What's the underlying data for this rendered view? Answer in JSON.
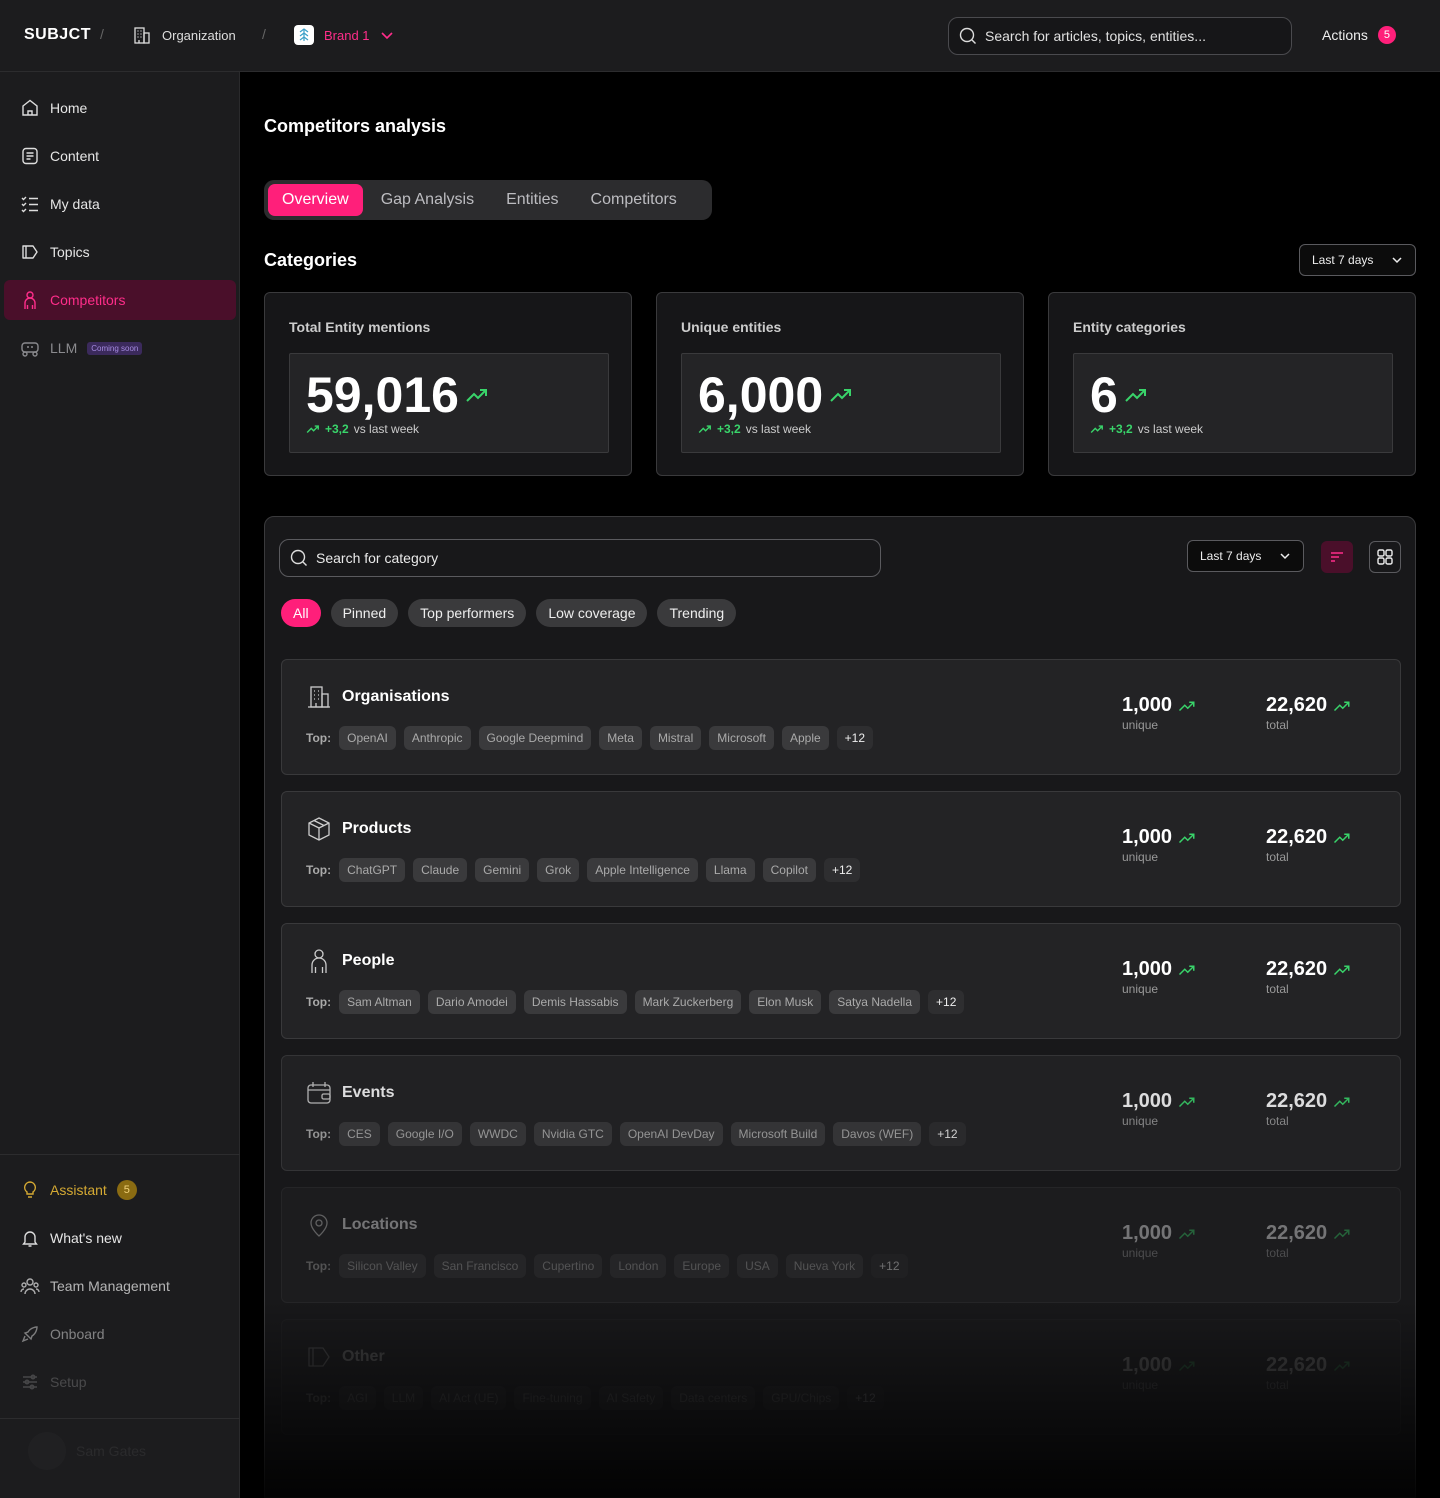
{
  "topbar": {
    "logo": "SUBJCT",
    "org_label": "Organization",
    "brand_label": "Brand 1",
    "search_placeholder": "Search for articles, topics, entities...",
    "actions_label": "Actions",
    "actions_count": "5"
  },
  "sidebar": {
    "items": [
      {
        "label": "Home",
        "icon": "home-icon"
      },
      {
        "label": "Content",
        "icon": "document-icon"
      },
      {
        "label": "My data",
        "icon": "checklist-icon"
      },
      {
        "label": "Topics",
        "icon": "tag-icon"
      },
      {
        "label": "Competitors",
        "icon": "person-icon",
        "active": true
      },
      {
        "label": "LLM",
        "icon": "robot-icon",
        "badge": "Coming soon"
      }
    ],
    "bottom": [
      {
        "label": "Assistant",
        "icon": "lightbulb-icon",
        "badge": "5"
      },
      {
        "label": "What's new",
        "icon": "bell-icon"
      },
      {
        "label": "Team Management",
        "icon": "team-icon"
      },
      {
        "label": "Onboard",
        "icon": "rocket-icon"
      },
      {
        "label": "Setup",
        "icon": "sliders-icon"
      }
    ],
    "user_name": "Sam Gates"
  },
  "page": {
    "title": "Competitors analysis",
    "tabs": [
      "Overview",
      "Gap Analysis",
      "Entities",
      "Competitors"
    ],
    "section_title": "Categories",
    "range_label": "Last 7 days"
  },
  "stats": [
    {
      "label": "Total Entity mentions",
      "value": "59,016",
      "delta": "+3,2",
      "delta_suffix": "vs last week"
    },
    {
      "label": "Unique entities",
      "value": "6,000",
      "delta": "+3,2",
      "delta_suffix": "vs last week"
    },
    {
      "label": "Entity categories",
      "value": "6",
      "delta": "+3,2",
      "delta_suffix": "vs last week"
    }
  ],
  "panel": {
    "search_placeholder": "Search for category",
    "range_label": "Last 7 days",
    "chips": [
      "All",
      "Pinned",
      "Top performers",
      "Low coverage",
      "Trending"
    ],
    "top_label": "Top:",
    "unique_label": "unique",
    "total_label": "total",
    "categories": [
      {
        "name": "Organisations",
        "icon": "building-icon",
        "tags": [
          "OpenAI",
          "Anthropic",
          "Google Deepmind",
          "Meta",
          "Mistral",
          "Microsoft",
          "Apple"
        ],
        "more": "+12",
        "unique": "1,000",
        "total": "22,620"
      },
      {
        "name": "Products",
        "icon": "box-icon",
        "tags": [
          "ChatGPT",
          "Claude",
          "Gemini",
          "Grok",
          "Apple Intelligence",
          "Llama",
          "Copilot"
        ],
        "more": "+12",
        "unique": "1,000",
        "total": "22,620"
      },
      {
        "name": "People",
        "icon": "person-icon",
        "tags": [
          "Sam Altman",
          "Dario Amodei",
          "Demis Hassabis",
          "Mark Zuckerberg",
          "Elon Musk",
          "Satya Nadella"
        ],
        "more": "+12",
        "unique": "1,000",
        "total": "22,620"
      },
      {
        "name": "Events",
        "icon": "calendar-icon",
        "tags": [
          "CES",
          "Google I/O",
          "WWDC",
          "Nvidia GTC",
          "OpenAI DevDay",
          "Microsoft Build",
          "Davos (WEF)"
        ],
        "more": "+12",
        "unique": "1,000",
        "total": "22,620"
      },
      {
        "name": "Locations",
        "icon": "location-icon",
        "tags": [
          "Silicon Valley",
          "San Francisco",
          "Cupertino",
          "London",
          "Europe",
          "USA",
          "Nueva York"
        ],
        "more": "+12",
        "unique": "1,000",
        "total": "22,620"
      },
      {
        "name": "Other",
        "icon": "tag-icon",
        "tags": [
          "AGI",
          "LLM",
          "AI Act (UE)",
          "Fine-tuning",
          "AI Safety",
          "Data centers",
          "GPU/Chips"
        ],
        "more": "+12",
        "unique": "1,000",
        "total": "22,620"
      }
    ]
  },
  "colors": {
    "accent": "#ff1f7a",
    "positive": "#39d46a",
    "assistant": "#d4a933"
  }
}
